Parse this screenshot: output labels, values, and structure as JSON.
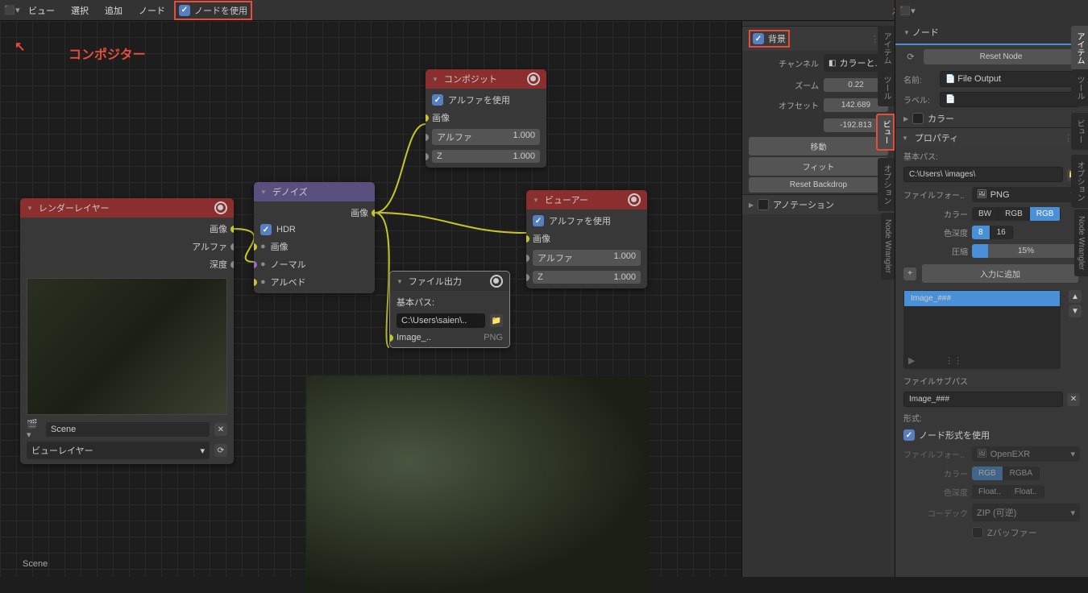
{
  "header": {
    "view": "ビュー",
    "select": "選択",
    "add": "追加",
    "node": "ノード",
    "use_nodes": "ノードを使用",
    "background_btn": "背景"
  },
  "annotation": "コンポジター",
  "nodes": {
    "render_layers": {
      "title": "レンダーレイヤー",
      "out_image": "画像",
      "out_alpha": "アルファ",
      "out_depth": "深度",
      "scene": "Scene",
      "view_layer": "ビューレイヤー"
    },
    "denoise": {
      "title": "デノイズ",
      "out_image": "画像",
      "hdr": "HDR",
      "in_image": "画像",
      "in_normal": "ノーマル",
      "in_albedo": "アルベド"
    },
    "composite": {
      "title": "コンポジット",
      "use_alpha": "アルファを使用",
      "image": "画像",
      "alpha": "アルファ",
      "alpha_val": "1.000",
      "z": "Z",
      "z_val": "1.000"
    },
    "viewer": {
      "title": "ビューアー",
      "use_alpha": "アルファを使用",
      "image": "画像",
      "alpha": "アルファ",
      "alpha_val": "1.000",
      "z": "Z",
      "z_val": "1.000"
    },
    "file_output": {
      "title": "ファイル出力",
      "base_path_lbl": "基本パス:",
      "base_path": "C:\\Users\\saien\\..",
      "slot": "Image_..",
      "fmt": "PNG"
    }
  },
  "scene_label": "Scene",
  "n_panel": {
    "bg": "背景",
    "channel": "チャンネル",
    "channel_val": "カラーと.. ",
    "zoom_lbl": "ズーム",
    "zoom": "0.22",
    "offset_lbl": "オフセット",
    "off_x": "142.689",
    "off_y": "-192.813",
    "move": "移動",
    "fit": "フィット",
    "reset": "Reset Backdrop",
    "annotation": "アノテーション",
    "tabs": {
      "item": "アイテム",
      "tool": "ツール",
      "view": "ビュー",
      "options": "オプション",
      "nw": "Node Wrangler"
    }
  },
  "props": {
    "node_head": "ノード",
    "reset_node": "Reset Node",
    "name_lbl": "名前:",
    "name": "File Output",
    "label_lbl": "ラベル:",
    "color": "カラー",
    "properties": "プロパティ",
    "base_path_lbl": "基本パス:",
    "base_path": "C:\\Users\\                      \\images\\",
    "ff_lbl": "ファイルフォー..",
    "ff": "PNG",
    "color_lbl": "カラー",
    "bw": "BW",
    "rgb": "RGB",
    "rgba": "RGB",
    "depth_lbl": "色深度",
    "d8": "8",
    "d16": "16",
    "compress_lbl": "圧縮",
    "compress": "15%",
    "add_input": "入力に追加",
    "list_item": "Image_###",
    "subpath_lbl": "ファイルサブパス",
    "subpath": "Image_###",
    "format_lbl": "形式:",
    "use_node_fmt": "ノード形式を使用",
    "ff2": "OpenEXR",
    "rgb2": "RGB",
    "rgba2": "RGBA",
    "depth2_lbl": "色深度",
    "float1": "Float..",
    "float2": "Float..",
    "codec_lbl": "コーデック",
    "codec": "ZIP (可逆)",
    "zbuf": "Zバッファー",
    "tabs": {
      "item": "アイテム",
      "tool": "ツール",
      "view": "ビュー",
      "options": "オプション",
      "nw": "Node Wrangler"
    }
  }
}
